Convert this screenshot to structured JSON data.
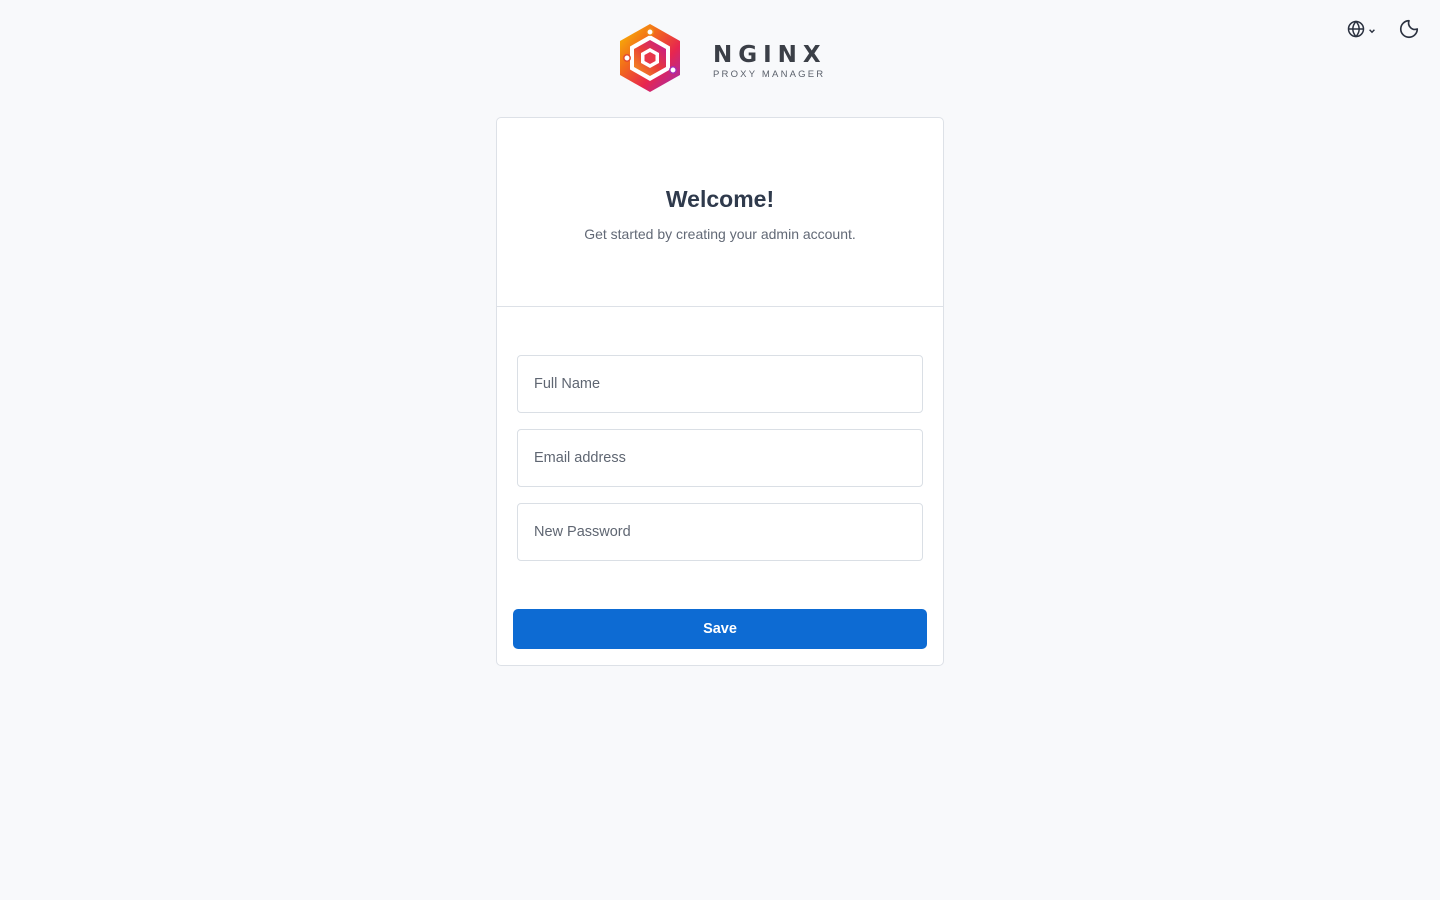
{
  "header": {
    "logo_title": "NGINX",
    "logo_subtitle": "PROXY MANAGER",
    "language_icon": "globe-icon",
    "theme_icon": "moon-icon"
  },
  "card": {
    "title": "Welcome!",
    "subtitle": "Get started by creating your admin account."
  },
  "form": {
    "full_name_placeholder": "Full Name",
    "full_name_value": "",
    "email_placeholder": "Email address",
    "email_value": "",
    "password_placeholder": "New Password",
    "password_value": "",
    "save_label": "Save"
  },
  "colors": {
    "primary": "#0d6bd3",
    "background": "#f8f9fb"
  }
}
